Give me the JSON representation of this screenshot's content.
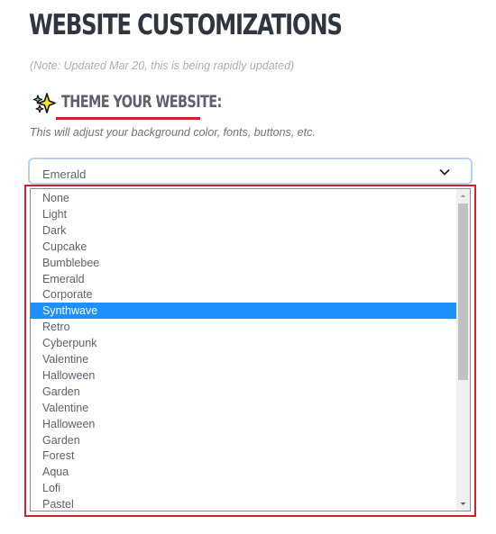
{
  "page": {
    "title": "WEBSITE CUSTOMIZATIONS",
    "note": "(Note: Updated Mar 20, this is being rapidly updated)"
  },
  "theme_section": {
    "icon": "sparkles-icon",
    "heading": "THEME YOUR WEBSITE:",
    "description": "This will adjust your background color, fonts, buttons, etc.",
    "select": {
      "value": "Emerald",
      "chevron_icon": "chevron-down-icon"
    },
    "options": [
      "None",
      "Light",
      "Dark",
      "Cupcake",
      "Bumblebee",
      "Emerald",
      "Corporate",
      "Synthwave",
      "Retro",
      "Cyberpunk",
      "Valentine",
      "Halloween",
      "Garden",
      "Valentine",
      "Halloween",
      "Garden",
      "Forest",
      "Aqua",
      "Lofi",
      "Pastel"
    ],
    "highlighted_option": "Synthwave",
    "scroll": {
      "thumb_start_fraction": 0.0,
      "thumb_size_fraction": 0.6
    }
  },
  "colors": {
    "accent_underline": "#d21f2b",
    "highlight_box": "#d0202c",
    "selected_option_bg": "#1e90ff",
    "select_border": "#b7d3f2"
  }
}
